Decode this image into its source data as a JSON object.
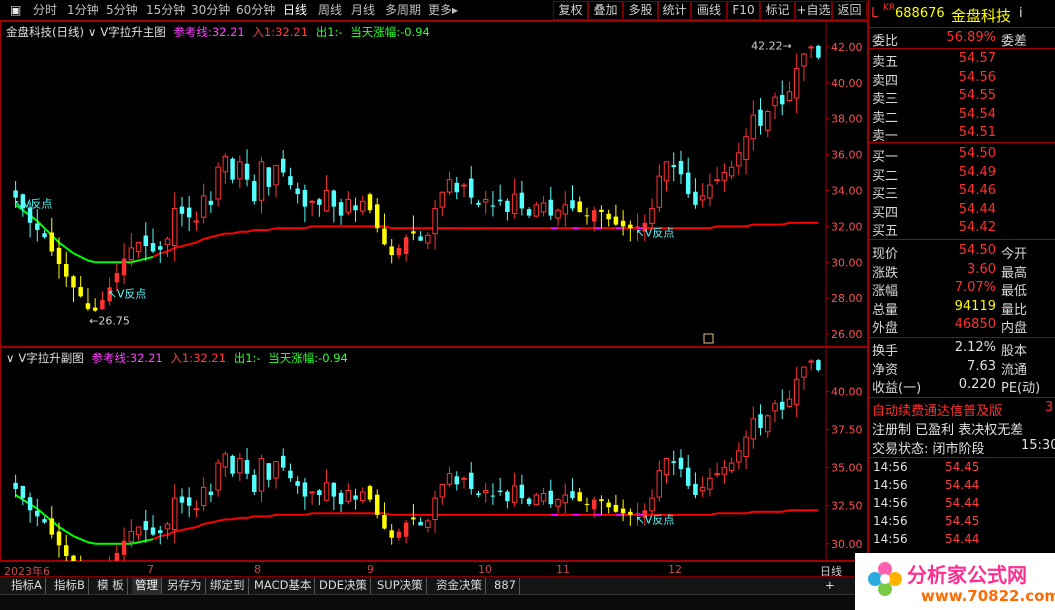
{
  "toolbar": {
    "periods": [
      "分时",
      "1分钟",
      "5分钟",
      "15分钟",
      "30分钟",
      "60分钟",
      "日线",
      "周线",
      "月线",
      "多周期",
      "更多▸"
    ],
    "active_period": "日线",
    "buttons": [
      "复权",
      "叠加",
      "多股",
      "统计",
      "画线",
      "F10",
      "标记",
      "+自选",
      "返回"
    ]
  },
  "main_panel": {
    "stock_title": "金盘科技(日线)",
    "indicator_name": "V字拉升主图",
    "ref_label": "参考线:",
    "ref_value": "32.21",
    "in_label": "入1:",
    "in_value": "32.21",
    "out_label": "出1:",
    "out_value": "-",
    "chg_label": "当天涨幅:",
    "chg_value": "-0.94",
    "price_ticks": [
      "42.00",
      "40.00",
      "38.00",
      "36.00",
      "34.00",
      "32.00",
      "30.00",
      "28.00",
      "26.00"
    ],
    "high_label": "42.22",
    "low_label": "26.75",
    "v_labels": [
      "V反点",
      "V反点",
      "V反点"
    ]
  },
  "sub_panel": {
    "indicator_name": "V字拉升副图",
    "ref_label": "参考线:",
    "ref_value": "32.21",
    "in_label": "入1:",
    "in_value": "32.21",
    "out_label": "出1:",
    "out_value": "-",
    "chg_label": "当天涨幅:",
    "chg_value": "-0.94",
    "price_ticks": [
      "40.00",
      "37.50",
      "35.00",
      "32.50",
      "30.00"
    ],
    "v_labels": [
      "V反点",
      "V反点"
    ]
  },
  "date_axis": {
    "ticks": [
      "2023年6",
      "7",
      "8",
      "9",
      "10",
      "11",
      "12"
    ],
    "right_label": "日线"
  },
  "bottom_tabs": {
    "tabs": [
      "指标A",
      "指标B",
      "模 板",
      "管理",
      "另存为",
      "绑定到",
      "MACD基本",
      "DDE决策",
      "SUP决策",
      "资金决策",
      "887"
    ],
    "active_tab": "管理",
    "add_btn": "+"
  },
  "quote": {
    "market_tag": "KR",
    "code": "688676",
    "name": "金盘科技",
    "info_btn": "i",
    "weibi_label": "委比",
    "weibi_value": "56.89%",
    "weicha_label": "委差",
    "asks": [
      {
        "label": "卖五",
        "price": "54.57"
      },
      {
        "label": "卖四",
        "price": "54.56"
      },
      {
        "label": "卖三",
        "price": "54.55"
      },
      {
        "label": "卖二",
        "price": "54.54"
      },
      {
        "label": "卖一",
        "price": "54.51"
      }
    ],
    "bids": [
      {
        "label": "买一",
        "price": "54.50"
      },
      {
        "label": "买二",
        "price": "54.49"
      },
      {
        "label": "买三",
        "price": "54.46"
      },
      {
        "label": "买四",
        "price": "54.44"
      },
      {
        "label": "买五",
        "price": "54.42"
      }
    ],
    "stats": [
      {
        "label": "现价",
        "value": "54.50",
        "label2": "今开"
      },
      {
        "label": "涨跌",
        "value": "3.60",
        "label2": "最高"
      },
      {
        "label": "涨幅",
        "value": "7.07%",
        "label2": "最低"
      },
      {
        "label": "总量",
        "value": "94119",
        "label2": "量比"
      },
      {
        "label": "外盘",
        "value": "46850",
        "label2": "内盘"
      }
    ],
    "stats2": [
      {
        "label": "换手",
        "value": "2.12%",
        "label2": "股本"
      },
      {
        "label": "净资",
        "value": "7.63",
        "label2": "流通"
      },
      {
        "label": "收益(一)",
        "value": "0.220",
        "label2": "PE(动)"
      }
    ],
    "banner1": "自动续费通达信普及版",
    "banner1_tail": "3",
    "banner2": "注册制 已盈利 表决权无差",
    "trade_status": "交易状态: 闭市阶段",
    "trade_time": "15:30",
    "ticks": [
      {
        "time": "14:56",
        "price": "54.45"
      },
      {
        "time": "14:56",
        "price": "54.44"
      },
      {
        "time": "14:56",
        "price": "54.44"
      },
      {
        "time": "14:56",
        "price": "54.45"
      },
      {
        "time": "14:56",
        "price": "54.44"
      }
    ]
  },
  "logo": {
    "title": "分析家公式网",
    "url": "www.70822.com"
  },
  "colors": {
    "up": "#ff3232",
    "down": "#54ffff",
    "yellow": "#ffff00",
    "ma_red": "#ff0000",
    "ma_green": "#00ff00",
    "magenta": "#ff00ff",
    "border": "#a00000"
  },
  "chart_data": {
    "type": "candlestick",
    "title": "金盘科技(日线)",
    "ylim": [
      25.5,
      43.0
    ],
    "sub_ylim": [
      29.0,
      42.0
    ],
    "close": [
      33.6,
      33.0,
      32.2,
      31.8,
      31.4,
      30.6,
      29.9,
      29.2,
      28.6,
      28.1,
      27.4,
      27.3,
      27.9,
      28.6,
      29.4,
      30.2,
      30.8,
      31.1,
      30.9,
      30.6,
      30.7,
      31.3,
      33.0,
      32.7,
      32.5,
      32.3,
      33.7,
      33.2,
      35.3,
      35.9,
      34.6,
      35.6,
      34.6,
      33.4,
      35.6,
      34.2,
      35.4,
      35.0,
      34.3,
      33.8,
      33.1,
      33.4,
      33.2,
      34.0,
      33.1,
      32.6,
      33.5,
      32.9,
      33.4,
      32.9,
      31.9,
      31.0,
      30.4,
      30.8,
      31.4,
      31.6,
      31.2,
      31.5,
      33.0,
      33.9,
      34.6,
      33.9,
      34.3,
      33.6,
      33.2,
      33.5,
      33.1,
      33.4,
      32.8,
      33.8,
      33.0,
      32.6,
      33.2,
      33.3,
      32.6,
      32.9,
      33.2,
      33.0,
      32.8,
      32.6,
      32.9,
      32.8,
      32.4,
      32.1,
      32.0,
      31.9,
      32.0,
      32.2,
      33.0,
      34.8,
      35.6,
      35.3,
      34.9,
      33.8,
      33.2,
      33.7,
      34.3,
      34.6,
      35.0,
      35.3,
      36.1,
      37.0,
      38.2,
      37.6,
      38.4,
      39.2,
      38.8,
      39.5,
      40.8,
      41.6,
      42.0,
      41.4
    ],
    "ma": [
      33.2,
      32.9,
      32.6,
      32.3,
      31.9,
      31.5,
      31.1,
      30.8,
      30.5,
      30.3,
      30.1,
      30.0,
      30.0,
      30.0,
      30.0,
      30.0,
      30.0,
      30.1,
      30.2,
      30.3,
      30.5,
      30.6,
      30.8,
      30.9,
      31.0,
      31.1,
      31.3,
      31.4,
      31.5,
      31.6,
      31.6,
      31.7,
      31.7,
      31.8,
      31.8,
      31.8,
      31.9,
      31.9,
      31.9,
      31.9,
      31.9,
      32.0,
      32.0,
      32.0,
      32.0,
      32.0,
      32.0,
      32.0,
      32.0,
      32.0,
      32.0,
      32.0,
      31.9,
      31.9,
      31.9,
      31.9,
      31.9,
      31.9,
      31.9,
      31.9,
      31.9,
      31.9,
      31.9,
      31.9,
      31.9,
      31.9,
      31.9,
      31.9,
      31.9,
      31.9,
      31.9,
      31.9,
      31.9,
      31.9,
      31.9,
      31.9,
      31.9,
      31.9,
      31.9,
      31.9,
      31.9,
      31.9,
      31.9,
      31.9,
      31.9,
      31.9,
      31.9,
      31.9,
      31.9,
      31.9,
      31.9,
      31.9,
      31.9,
      31.9,
      31.9,
      31.9,
      31.9,
      32.0,
      32.0,
      32.0,
      32.0,
      32.0,
      32.1,
      32.1,
      32.1,
      32.1,
      32.1,
      32.2,
      32.2,
      32.2,
      32.2,
      32.2
    ]
  }
}
